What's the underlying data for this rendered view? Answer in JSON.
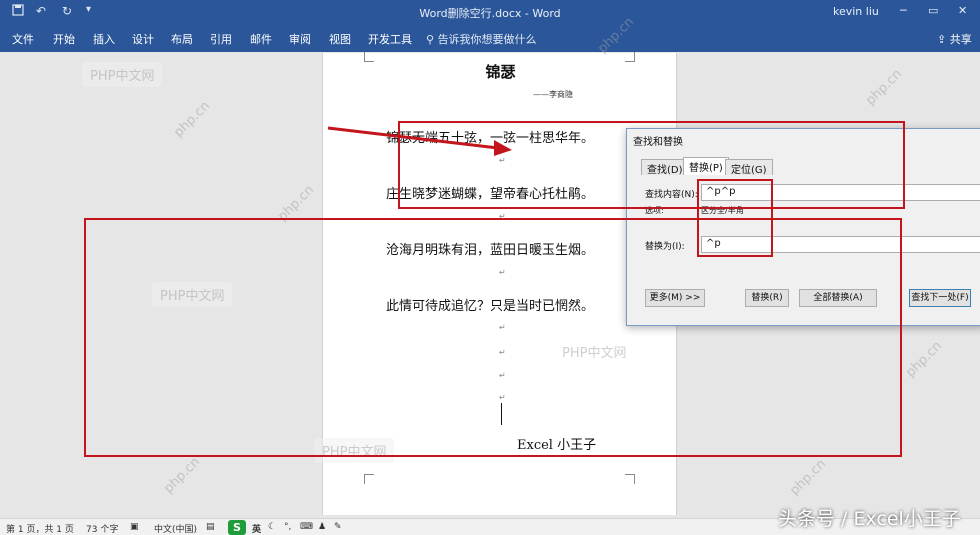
{
  "titlebar": {
    "document_title": "Word删除空行.docx - Word",
    "user": "kevin liu",
    "save_icon": "save-icon",
    "undo_icon": "undo-icon",
    "redo_icon": "redo-icon",
    "minimize": "─",
    "restore": "▭",
    "close": "✕"
  },
  "ribbon": {
    "tabs": [
      "文件",
      "开始",
      "插入",
      "设计",
      "布局",
      "引用",
      "邮件",
      "审阅",
      "视图",
      "开发工具"
    ],
    "tell_me": "告诉我你想要做什么",
    "share": "共享"
  },
  "document": {
    "title": "锦瑟",
    "author": "——李商隐",
    "lines": [
      "锦瑟无端五十弦，一弦一柱思华年。",
      "庄生晓梦迷蝴蝶，望帝春心托杜鹃。",
      "沧海月明珠有泪，蓝田日暖玉生烟。",
      "此情可待成追忆？只是当时已惘然。"
    ],
    "paragraph_mark": "↵",
    "signature": "Excel 小王子"
  },
  "dialog": {
    "title": "查找和替换",
    "tabs": [
      "查找(D)",
      "替换(P)",
      "定位(G)"
    ],
    "active_tab": "替换(P)",
    "find_label": "查找内容(N):",
    "find_value": "^p^p",
    "options_label": "选项:",
    "options_value": "区分全/半角",
    "replace_label": "替换为(I):",
    "replace_value": "^p",
    "buttons": {
      "more": "更多(M) >>",
      "replace": "替换(R)",
      "replace_all": "全部替换(A)",
      "find_next": "查找下一处(F)"
    }
  },
  "status": {
    "page": "第 1 页，共 1 页",
    "words": "73 个字",
    "language": "中文(中国)",
    "ime_label": "S",
    "ime_lang": "英"
  },
  "watermarks": [
    "PHP中文网",
    "php.cn"
  ],
  "credit": "头条号 / Excel小王子",
  "colors": {
    "ribbon": "#2b579a",
    "annotation": "#c3161c"
  }
}
